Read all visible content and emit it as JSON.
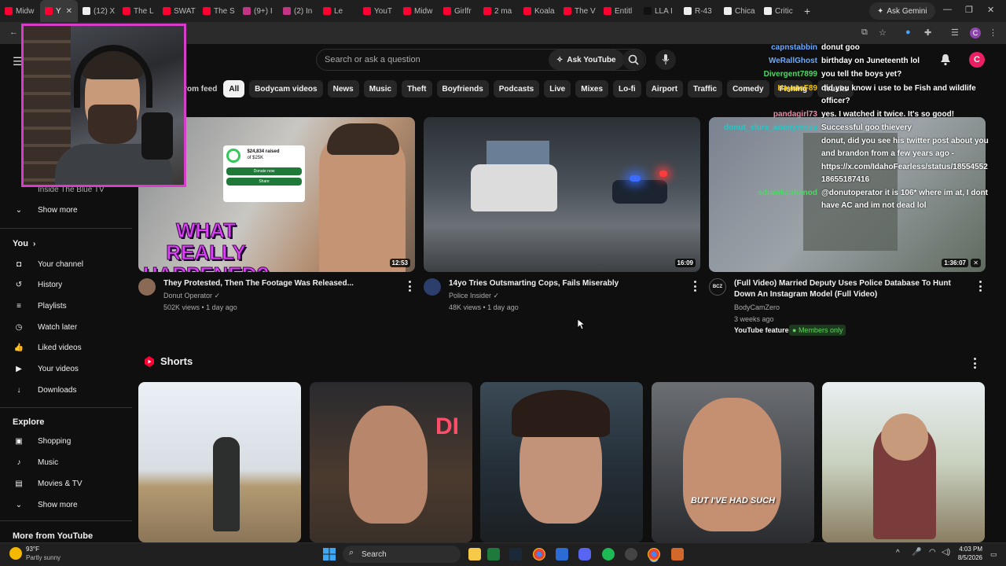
{
  "browser": {
    "tabs": [
      "Midw",
      "Y",
      "(12) X",
      "The L",
      "SWAT",
      "The S",
      "(9+) I",
      "(2) In",
      "Le",
      "YouT",
      "Midw",
      "Girlfr",
      "2 ma",
      "Koala",
      "The V",
      "Entitl",
      "LLA I",
      "R-43",
      "Chica",
      "Critic"
    ],
    "ask_gemini": "Ask Gemini",
    "profile_letter": "C"
  },
  "youtube": {
    "search_placeholder": "Search or ask a question",
    "ask_youtube": "Ask YouTube",
    "create_label": "Create",
    "avatar_letter": "C",
    "chips": [
      "From feed",
      "All",
      "Bodycam videos",
      "News",
      "Music",
      "Theft",
      "Boyfriends",
      "Podcasts",
      "Live",
      "Mixes",
      "Lo-fi",
      "Airport",
      "Traffic",
      "Comedy",
      "Fishing",
      "Trucks"
    ],
    "sidebar": {
      "partial_item": "Inside The Blue TV",
      "show_more": "Show more",
      "you_heading": "You",
      "you_items": [
        "Your channel",
        "History",
        "Playlists",
        "Watch later",
        "Liked videos",
        "Your videos",
        "Downloads"
      ],
      "explore_heading": "Explore",
      "explore_items": [
        "Shopping",
        "Music",
        "Movies & TV"
      ],
      "explore_show_more": "Show more",
      "more_heading": "More from YouTube"
    },
    "videos": [
      {
        "title": "They Protested, Then The Footage Was Released...",
        "channel": "Donut Operator",
        "meta": "502K views • 1 day ago",
        "duration": "12:53",
        "overlay_text": "WHAT REALLY HAPPENED?",
        "donation_amount": "$24,834 raised",
        "donation_goal": "of $25K",
        "donate_btn": "Donate now",
        "share_btn": "Share"
      },
      {
        "title": "14yo Tries Outsmarting Cops, Fails Miserably",
        "channel": "Police Insider",
        "meta": "48K views • 1 day ago",
        "duration": "16:09"
      },
      {
        "title_line1": "(Full Video) Married Deputy Uses Police Database To Hunt",
        "title_line2": "Down An Instagram Model (Full Video)",
        "channel": "BodyCamZero",
        "channel_badge": "BCZ",
        "meta": "3 weeks ago",
        "featured": "YouTube featured",
        "members": "Members only",
        "duration": "1:36:07"
      }
    ],
    "shorts_heading": "Shorts",
    "short_caption": "BUT I'VE HAD SUCH"
  },
  "chat": [
    {
      "user": "capnstabbin",
      "msg": "donut goo",
      "color": "#6aa9ff"
    },
    {
      "user": "WeRallGhost",
      "msg": "birthday on Juneteenth lol",
      "color": "#6aa9ff"
    },
    {
      "user": "Divergent7899",
      "msg": "you tell the boys yet?",
      "color": "#4cd964"
    },
    {
      "user": "HayatoF89",
      "msg": "did you know i use to be Fish and wildlife",
      "color": "#f1c40f"
    },
    {
      "user": "",
      "msg": "officer?",
      "color": "#ffffff"
    },
    {
      "user": "pandagirl73",
      "msg": "yes. I watched it twice. It's so good!",
      "color": "#e88aa8"
    },
    {
      "user": "donut_slurs_anonymous",
      "msg": "Successful goo thievery",
      "color": "#2fc4c4"
    },
    {
      "user": "",
      "msg": "donut, did you see his twitter post about you",
      "color": "#ffffff"
    },
    {
      "user": "",
      "msg": "and brandon from a few years ago -",
      "color": "#ffffff"
    },
    {
      "user": "",
      "msg": "https://x.com/IdahoFearless/status/18554552",
      "color": "#ffffff"
    },
    {
      "user": "",
      "msg": "18655187416",
      "color": "#ffffff"
    },
    {
      "user": "sdrawkcabenod",
      "msg": "@donutoperator it is 106* where im at, I dont",
      "color": "#4cd964"
    },
    {
      "user": "",
      "msg": "have AC and im not dead lol",
      "color": "#ffffff"
    }
  ],
  "taskbar": {
    "temp": "93°F",
    "weather": "Partly sunny",
    "search": "Search",
    "time": "4:03 PM",
    "date": "8/5/2026"
  }
}
